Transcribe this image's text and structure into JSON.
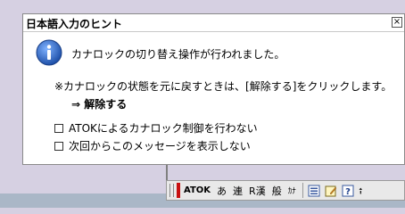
{
  "popup": {
    "title": "日本語入力のヒント",
    "close_glyph": "×",
    "message": "カナロックの切り替え操作が行われました。",
    "note": "※カナロックの状態を元に戻すときは、[解除する]をクリックします。",
    "restore_link": "⇒ 解除する",
    "options": [
      {
        "label": "ATOKによるカナロック制御を行わない",
        "checked": false
      },
      {
        "label": "次回からこのメッセージを表示しない",
        "checked": false
      }
    ]
  },
  "toolbar": {
    "atok": "ATOK",
    "input_mode": "あ",
    "conversion_mode": "連",
    "r_kanji": "R漢",
    "general": "般",
    "kana": "ｶﾅ",
    "icons": [
      "menu-icon",
      "memo-icon",
      "help-icon",
      "scroll-icon"
    ]
  }
}
